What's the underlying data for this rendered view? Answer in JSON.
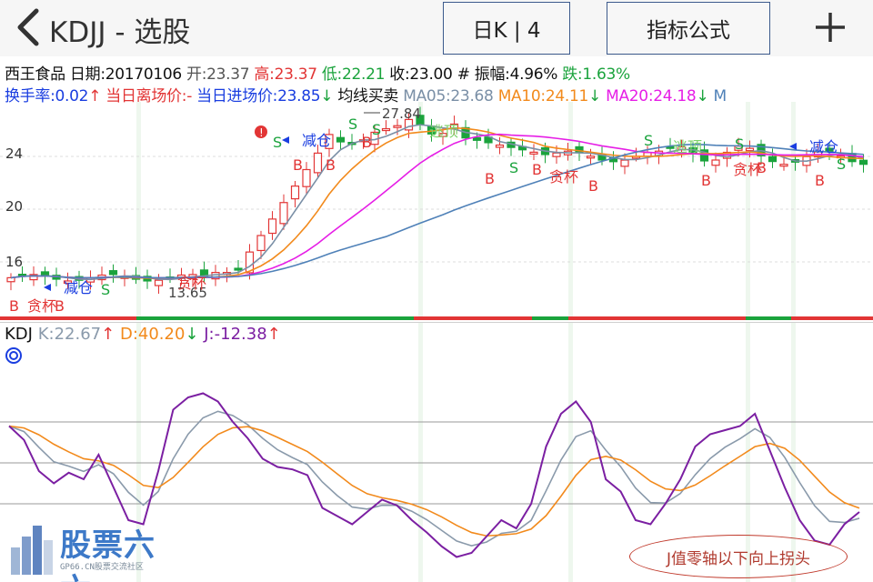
{
  "nav": {
    "title": "KDJJ - 选股",
    "period_button": "日K | 4",
    "formula_button": "指标公式"
  },
  "stock": {
    "name": "西王食品",
    "date_label": "日期:",
    "date": "20170106",
    "open_label": "开:",
    "open": "23.37",
    "high_label": "高:",
    "high": "23.37",
    "low_label": "低:",
    "low": "22.21",
    "close_label": "收:",
    "close": "23.00",
    "amp_label": "# 振幅:",
    "amplitude": "4.96%",
    "change_label": "跌:",
    "change": "1.63%"
  },
  "indicators": {
    "turnover_label": "换手率:",
    "turnover": "0.02",
    "exit_label": "当日离场价:",
    "exit_price": "-",
    "entry_label": "当日进场价:",
    "entry_price": "23.85",
    "strategy": "均线买卖",
    "ma05_label": "MA05:",
    "ma05": "23.68",
    "ma10_label": "MA10:",
    "ma10": "24.11",
    "ma20_label": "MA20:",
    "ma20": "24.18",
    "ma_more": "M"
  },
  "kdj": {
    "name": "KDJ",
    "k_label": "K:",
    "k": "22.67",
    "d_label": "D:",
    "d": "40.20",
    "j_label": "J:",
    "j": "-12.38"
  },
  "chart_data": [
    {
      "type": "candlestick",
      "y_ticks": [
        "24",
        "20",
        "16"
      ],
      "max_label": "27.84",
      "min_label": "13.65",
      "signal_labels": {
        "buy": "B",
        "sell": "S",
        "reduce": "减仓",
        "greedy": "贪杯",
        "escape": "逃顶"
      },
      "series": [
        {
          "name": "MA05",
          "color": "#7a8fa6"
        },
        {
          "name": "MA10",
          "color": "#f28a1c"
        },
        {
          "name": "MA20",
          "color": "#e61ee6"
        },
        {
          "name": "",
          "color": "#4f81b8"
        }
      ]
    },
    {
      "type": "line",
      "series": [
        {
          "name": "K",
          "color": "#8a9aab"
        },
        {
          "name": "D",
          "color": "#f28a1c"
        },
        {
          "name": "J",
          "color": "#7b1fa2"
        }
      ]
    }
  ],
  "colors": {
    "up": "#e23535",
    "down": "#1aa33c",
    "text_blue": "#1a3ee0",
    "text_green": "#1aa33c"
  },
  "watermark": {
    "logo": "股票六六",
    "site": "GP66.CN股票交流社区"
  },
  "annotation": "J值零轴以下向上拐头"
}
